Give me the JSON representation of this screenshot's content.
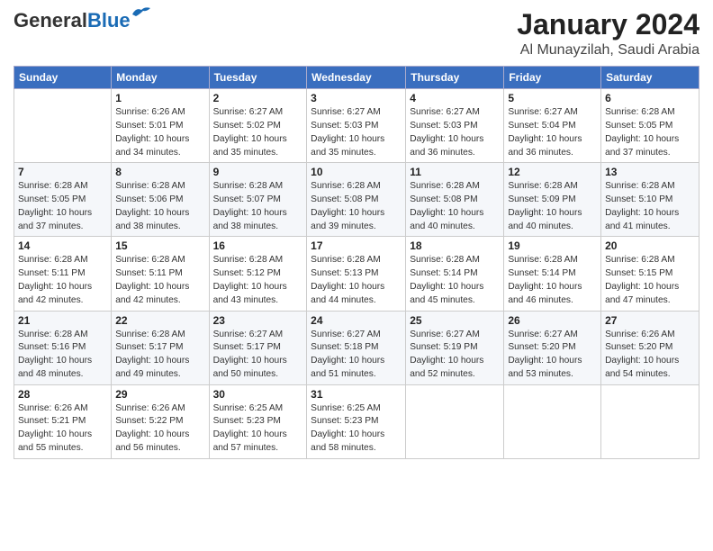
{
  "logo": {
    "general": "General",
    "blue": "Blue"
  },
  "header": {
    "month": "January 2024",
    "location": "Al Munayzilah, Saudi Arabia"
  },
  "weekdays": [
    "Sunday",
    "Monday",
    "Tuesday",
    "Wednesday",
    "Thursday",
    "Friday",
    "Saturday"
  ],
  "weeks": [
    [
      {
        "day": "",
        "info": ""
      },
      {
        "day": "1",
        "info": "Sunrise: 6:26 AM\nSunset: 5:01 PM\nDaylight: 10 hours\nand 34 minutes."
      },
      {
        "day": "2",
        "info": "Sunrise: 6:27 AM\nSunset: 5:02 PM\nDaylight: 10 hours\nand 35 minutes."
      },
      {
        "day": "3",
        "info": "Sunrise: 6:27 AM\nSunset: 5:03 PM\nDaylight: 10 hours\nand 35 minutes."
      },
      {
        "day": "4",
        "info": "Sunrise: 6:27 AM\nSunset: 5:03 PM\nDaylight: 10 hours\nand 36 minutes."
      },
      {
        "day": "5",
        "info": "Sunrise: 6:27 AM\nSunset: 5:04 PM\nDaylight: 10 hours\nand 36 minutes."
      },
      {
        "day": "6",
        "info": "Sunrise: 6:28 AM\nSunset: 5:05 PM\nDaylight: 10 hours\nand 37 minutes."
      }
    ],
    [
      {
        "day": "7",
        "info": "Sunrise: 6:28 AM\nSunset: 5:05 PM\nDaylight: 10 hours\nand 37 minutes."
      },
      {
        "day": "8",
        "info": "Sunrise: 6:28 AM\nSunset: 5:06 PM\nDaylight: 10 hours\nand 38 minutes."
      },
      {
        "day": "9",
        "info": "Sunrise: 6:28 AM\nSunset: 5:07 PM\nDaylight: 10 hours\nand 38 minutes."
      },
      {
        "day": "10",
        "info": "Sunrise: 6:28 AM\nSunset: 5:08 PM\nDaylight: 10 hours\nand 39 minutes."
      },
      {
        "day": "11",
        "info": "Sunrise: 6:28 AM\nSunset: 5:08 PM\nDaylight: 10 hours\nand 40 minutes."
      },
      {
        "day": "12",
        "info": "Sunrise: 6:28 AM\nSunset: 5:09 PM\nDaylight: 10 hours\nand 40 minutes."
      },
      {
        "day": "13",
        "info": "Sunrise: 6:28 AM\nSunset: 5:10 PM\nDaylight: 10 hours\nand 41 minutes."
      }
    ],
    [
      {
        "day": "14",
        "info": "Sunrise: 6:28 AM\nSunset: 5:11 PM\nDaylight: 10 hours\nand 42 minutes."
      },
      {
        "day": "15",
        "info": "Sunrise: 6:28 AM\nSunset: 5:11 PM\nDaylight: 10 hours\nand 42 minutes."
      },
      {
        "day": "16",
        "info": "Sunrise: 6:28 AM\nSunset: 5:12 PM\nDaylight: 10 hours\nand 43 minutes."
      },
      {
        "day": "17",
        "info": "Sunrise: 6:28 AM\nSunset: 5:13 PM\nDaylight: 10 hours\nand 44 minutes."
      },
      {
        "day": "18",
        "info": "Sunrise: 6:28 AM\nSunset: 5:14 PM\nDaylight: 10 hours\nand 45 minutes."
      },
      {
        "day": "19",
        "info": "Sunrise: 6:28 AM\nSunset: 5:14 PM\nDaylight: 10 hours\nand 46 minutes."
      },
      {
        "day": "20",
        "info": "Sunrise: 6:28 AM\nSunset: 5:15 PM\nDaylight: 10 hours\nand 47 minutes."
      }
    ],
    [
      {
        "day": "21",
        "info": "Sunrise: 6:28 AM\nSunset: 5:16 PM\nDaylight: 10 hours\nand 48 minutes."
      },
      {
        "day": "22",
        "info": "Sunrise: 6:28 AM\nSunset: 5:17 PM\nDaylight: 10 hours\nand 49 minutes."
      },
      {
        "day": "23",
        "info": "Sunrise: 6:27 AM\nSunset: 5:17 PM\nDaylight: 10 hours\nand 50 minutes."
      },
      {
        "day": "24",
        "info": "Sunrise: 6:27 AM\nSunset: 5:18 PM\nDaylight: 10 hours\nand 51 minutes."
      },
      {
        "day": "25",
        "info": "Sunrise: 6:27 AM\nSunset: 5:19 PM\nDaylight: 10 hours\nand 52 minutes."
      },
      {
        "day": "26",
        "info": "Sunrise: 6:27 AM\nSunset: 5:20 PM\nDaylight: 10 hours\nand 53 minutes."
      },
      {
        "day": "27",
        "info": "Sunrise: 6:26 AM\nSunset: 5:20 PM\nDaylight: 10 hours\nand 54 minutes."
      }
    ],
    [
      {
        "day": "28",
        "info": "Sunrise: 6:26 AM\nSunset: 5:21 PM\nDaylight: 10 hours\nand 55 minutes."
      },
      {
        "day": "29",
        "info": "Sunrise: 6:26 AM\nSunset: 5:22 PM\nDaylight: 10 hours\nand 56 minutes."
      },
      {
        "day": "30",
        "info": "Sunrise: 6:25 AM\nSunset: 5:23 PM\nDaylight: 10 hours\nand 57 minutes."
      },
      {
        "day": "31",
        "info": "Sunrise: 6:25 AM\nSunset: 5:23 PM\nDaylight: 10 hours\nand 58 minutes."
      },
      {
        "day": "",
        "info": ""
      },
      {
        "day": "",
        "info": ""
      },
      {
        "day": "",
        "info": ""
      }
    ]
  ]
}
